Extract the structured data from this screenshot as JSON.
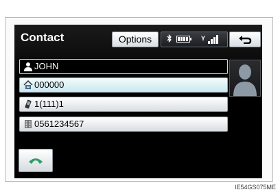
{
  "header": {
    "title": "Contact",
    "options_label": "Options",
    "signal_label": "Y"
  },
  "icons": {
    "bluetooth": "bluetooth-icon",
    "battery": "battery-icon",
    "signal": "signal-icon",
    "back": "back-arrow-icon",
    "person": "person-icon",
    "home_phone": "home-phone-icon",
    "mobile": "mobile-phone-icon",
    "office": "office-phone-icon",
    "call": "call-icon"
  },
  "contact": {
    "name": "JOHN",
    "numbers": [
      {
        "type": "home",
        "value": "000000",
        "highlighted": true
      },
      {
        "type": "mobile",
        "value": "1(111)1",
        "highlighted": false
      },
      {
        "type": "office",
        "value": "0561234567",
        "highlighted": false
      }
    ]
  },
  "caption": "IE54GS075ME",
  "colors": {
    "screen_bg": "#000000",
    "highlight": "#cbe8ef",
    "call_icon": "#2f9c6a"
  }
}
